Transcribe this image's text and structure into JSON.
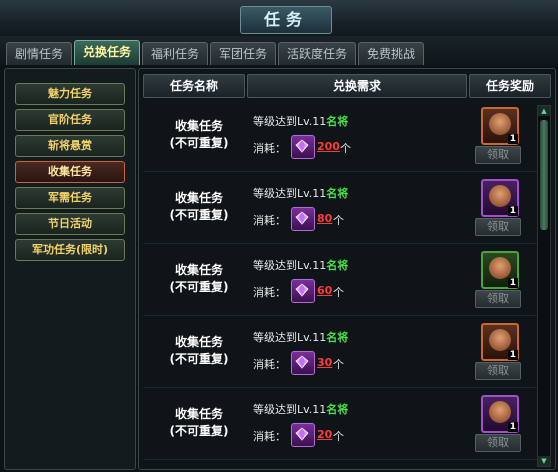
{
  "window": {
    "title": "任务"
  },
  "tabs": [
    {
      "label": "剧情任务",
      "active": false
    },
    {
      "label": "兑换任务",
      "active": true
    },
    {
      "label": "福利任务",
      "active": false
    },
    {
      "label": "军团任务",
      "active": false
    },
    {
      "label": "活跃度任务",
      "active": false
    },
    {
      "label": "免费挑战",
      "active": false
    }
  ],
  "sidebar": {
    "items": [
      {
        "label": "魅力任务",
        "active": false
      },
      {
        "label": "官阶任务",
        "active": false
      },
      {
        "label": "斩将悬赏",
        "active": false
      },
      {
        "label": "收集任务",
        "active": true
      },
      {
        "label": "军需任务",
        "active": false
      },
      {
        "label": "节日活动",
        "active": false
      },
      {
        "label": "军功任务(限时)",
        "active": false
      }
    ]
  },
  "table": {
    "columns": [
      "任务名称",
      "兑换需求",
      "任务奖励"
    ],
    "rows": [
      {
        "name": "收集任务",
        "note": "(不可重复)",
        "req_prefix": "等级达到Lv.11",
        "req_suffix": "名将",
        "cost_label": "消耗：",
        "cost": "200",
        "unit": "个",
        "reward_qty": "1",
        "reward_frame": "orange",
        "claim": "领取"
      },
      {
        "name": "收集任务",
        "note": "(不可重复)",
        "req_prefix": "等级达到Lv.11",
        "req_suffix": "名将",
        "cost_label": "消耗：",
        "cost": "80",
        "unit": "个",
        "reward_qty": "1",
        "reward_frame": "purple",
        "claim": "领取"
      },
      {
        "name": "收集任务",
        "note": "(不可重复)",
        "req_prefix": "等级达到Lv.11",
        "req_suffix": "名将",
        "cost_label": "消耗：",
        "cost": "60",
        "unit": "个",
        "reward_qty": "1",
        "reward_frame": "green",
        "claim": "领取"
      },
      {
        "name": "收集任务",
        "note": "(不可重复)",
        "req_prefix": "等级达到Lv.11",
        "req_suffix": "名将",
        "cost_label": "消耗：",
        "cost": "30",
        "unit": "个",
        "reward_qty": "1",
        "reward_frame": "orange",
        "claim": "领取"
      },
      {
        "name": "收集任务",
        "note": "(不可重复)",
        "req_prefix": "等级达到Lv.11",
        "req_suffix": "名将",
        "cost_label": "消耗：",
        "cost": "20",
        "unit": "个",
        "reward_qty": "1",
        "reward_frame": "purple",
        "claim": "领取"
      }
    ]
  },
  "colors": {
    "accent": "#f2d26a",
    "cost": "#ff3a3a",
    "highlight": "#48e048"
  }
}
